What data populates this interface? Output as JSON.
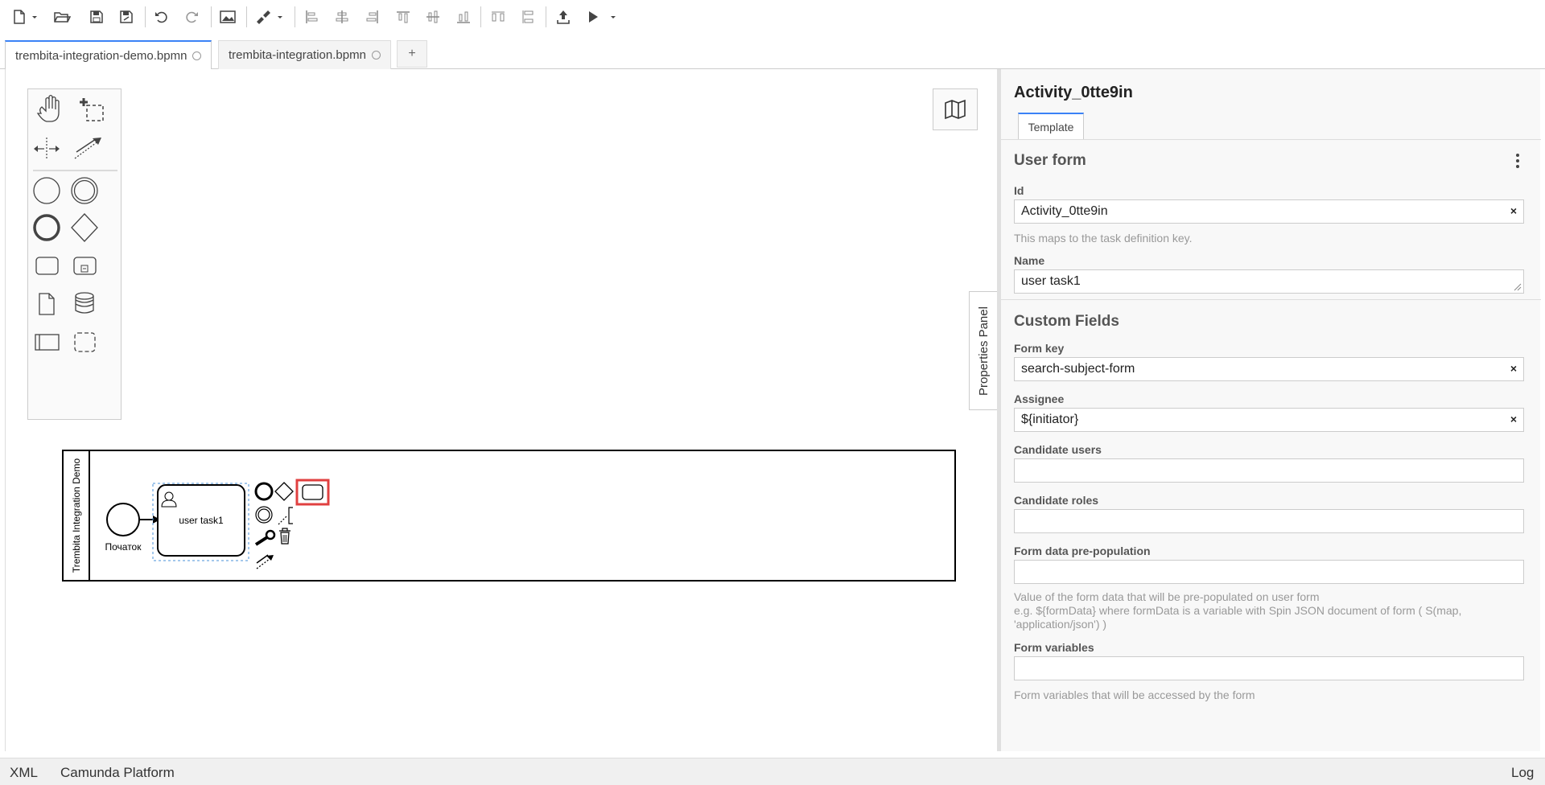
{
  "toolbar": {
    "icons": [
      "new-file-icon",
      "open-icon",
      "save-icon",
      "save-as-icon",
      "undo-icon",
      "redo-icon",
      "export-image-icon",
      "color-brush-icon",
      "align-left-icon",
      "align-center-icon",
      "align-right-icon",
      "align-top-icon",
      "align-middle-icon",
      "align-bottom-icon",
      "distribute-horizontal-icon",
      "distribute-vertical-icon",
      "deploy-icon",
      "start-instance-icon"
    ]
  },
  "tabs": [
    {
      "label": "trembita-integration-demo.bpmn",
      "active": true
    },
    {
      "label": "trembita-integration.bpmn",
      "active": false
    }
  ],
  "add_tab_label": "+",
  "diagram": {
    "pool_label": "Trembita Integration Demo",
    "start_event_label": "Початок",
    "task_label": "user task1"
  },
  "properties": {
    "toggle_label": "Properties Panel",
    "element_id": "Activity_0tte9in",
    "tab": "Template",
    "group_title": "User form",
    "fields": {
      "id": {
        "label": "Id",
        "value": "Activity_0tte9in",
        "hint": "This maps to the task definition key."
      },
      "name": {
        "label": "Name",
        "value": "user task1"
      }
    },
    "custom_title": "Custom Fields",
    "custom": {
      "form_key": {
        "label": "Form key",
        "value": "search-subject-form"
      },
      "assignee": {
        "label": "Assignee",
        "value": "${initiator}"
      },
      "candidate_users": {
        "label": "Candidate users",
        "value": ""
      },
      "candidate_roles": {
        "label": "Candidate roles",
        "value": ""
      },
      "prepopulation": {
        "label": "Form data pre-population",
        "value": "",
        "hint_line1": "Value of the form data that will be pre-populated on user form",
        "hint_line2": "e.g. ${formData} where formData is a variable with Spin JSON document of form ( S(map,",
        "hint_line3": "'application/json') )"
      },
      "form_variables": {
        "label": "Form variables",
        "value": "",
        "hint": "Form variables that will be accessed by the form"
      }
    },
    "clear_symbol": "×"
  },
  "status": {
    "xml": "XML",
    "platform": "Camunda Platform",
    "log": "Log"
  }
}
